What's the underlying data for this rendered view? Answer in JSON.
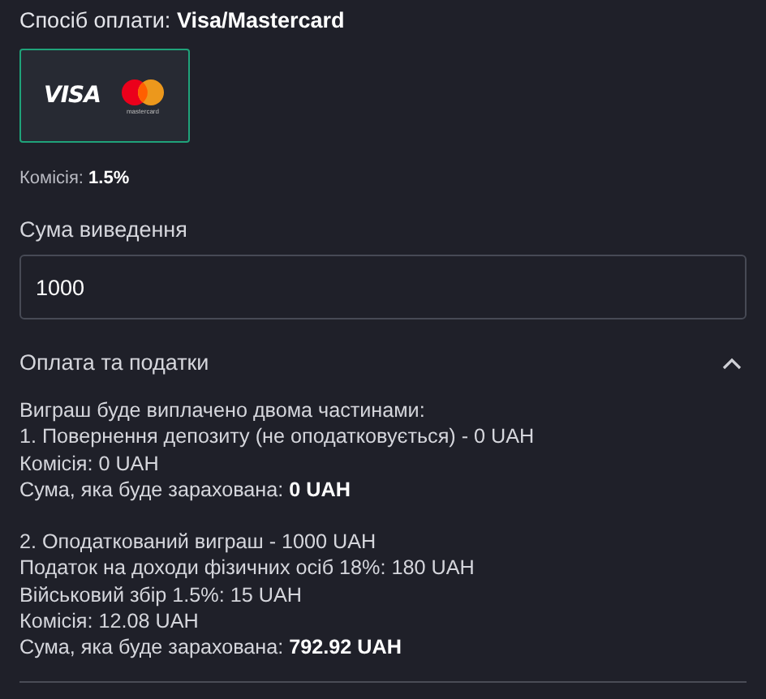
{
  "payment_method": {
    "label": "Спосіб оплати:",
    "value": "Visa/Mastercard"
  },
  "method_cards": [
    {
      "visa_text": "VISA",
      "mastercard_text": "mastercard",
      "selected": true
    }
  ],
  "commission": {
    "label": "Комісія:",
    "value": "1.5%"
  },
  "amount_field": {
    "label": "Сума виведення",
    "value": "1000"
  },
  "taxes_section": {
    "title": "Оплата та податки",
    "expanded": true,
    "paragraphs": [
      [
        "Виграш буде виплачено двома частинами:",
        "1. Повернення депозиту (не оподатковується) - 0 UAH",
        "Комісія: 0 UAH",
        "Сума, яка буде зарахована: **0 UAH**"
      ],
      [
        "2. Оподаткований виграш - 1000 UAH",
        "Податок на доходи фізичних осіб 18%: 180 UAH",
        "Військовий збір 1.5%: 15 UAH",
        "Комісія: 12.08 UAH",
        "Сума, яка буде зарахована: **792.92 UAH**"
      ]
    ]
  }
}
